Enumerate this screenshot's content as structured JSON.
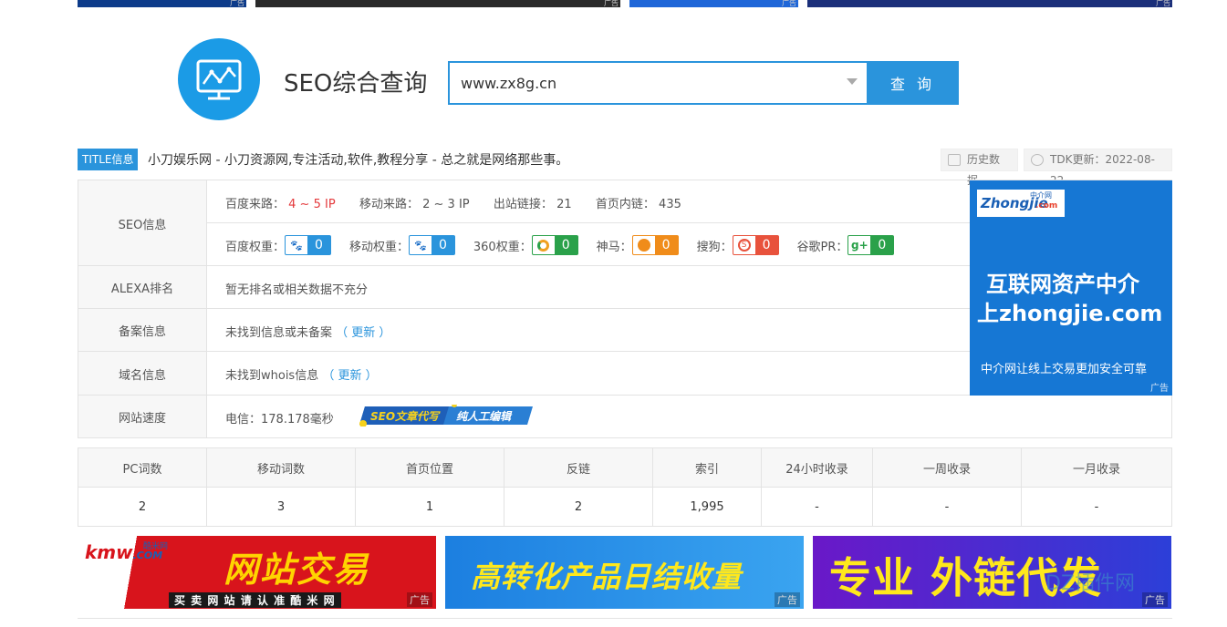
{
  "top_ads": {
    "ad_tag": "广告"
  },
  "header": {
    "page_title": "SEO综合查询",
    "search_value": "www.zx8g.cn",
    "search_button": "查 询"
  },
  "title_row": {
    "badge": "TITLE信息",
    "text": "小刀娱乐网 - 小刀资源网,专注活动,软件,教程分享 - 总之就是网络那些事。",
    "history_button": "历史数据",
    "tdk_update": "TDK更新：2022-08-22"
  },
  "seo_info": {
    "label": "SEO信息",
    "baidu_source_label": "百度来路：",
    "baidu_source_value": "4 ~ 5 IP",
    "mobile_source_label": "移动来路：",
    "mobile_source_value": "2 ~ 3 IP",
    "outbound_label": "出站链接：",
    "outbound_value": "21",
    "home_internal_label": "首页内链：",
    "home_internal_value": "435",
    "weights": [
      {
        "label": "百度权重：",
        "value": "0",
        "color": "#2a94dc",
        "icon": "paw-icon"
      },
      {
        "label": "移动权重：",
        "value": "0",
        "color": "#2a94dc",
        "icon": "paw-icon"
      },
      {
        "label": "360权重：",
        "value": "0",
        "color": "#2aa14a",
        "icon": "circle-360-icon"
      },
      {
        "label": "神马：",
        "value": "0",
        "color": "#f08c1a",
        "icon": "horse-icon"
      },
      {
        "label": "搜狗：",
        "value": "0",
        "color": "#e8523c",
        "icon": "sogou-icon"
      },
      {
        "label": "谷歌PR：",
        "value": "0",
        "color": "#2aa14a",
        "icon": "google-plus-icon"
      }
    ]
  },
  "alexa": {
    "label": "ALEXA排名",
    "value": "暂无排名或相关数据不充分"
  },
  "icp": {
    "label": "备案信息",
    "value": "未找到信息或未备案",
    "link": "（ 更新 ）"
  },
  "whois": {
    "label": "域名信息",
    "value": "未找到whois信息",
    "link": "（ 更新 ）"
  },
  "speed": {
    "label": "网站速度",
    "value": "电信：178.178毫秒",
    "banner_a": "SEO文章代写",
    "banner_b": "纯人工编辑"
  },
  "side_ad": {
    "brand": "Zhongjie",
    "brand_suffix": ".com",
    "brand_cn": "中介网",
    "line1": "互联网资产中介",
    "line2_prefix": "上",
    "line2_domain": "zhongjie.com",
    "line3": "中介网让线上交易更加安全可靠",
    "tag": "广告"
  },
  "stats": {
    "headers": [
      "PC词数",
      "移动词数",
      "首页位置",
      "反链",
      "索引",
      "24小时收录",
      "一周收录",
      "一月收录"
    ],
    "values": [
      "2",
      "3",
      "1",
      "2",
      "1,995",
      "-",
      "-",
      "-"
    ]
  },
  "bottom_ads": [
    {
      "brand": "kmw",
      "brand_suffix": ".COM",
      "brand_cn": "酷米网",
      "headline": "网站交易",
      "sub": "买 卖 网 站 请 认 准 酷 米 网",
      "tag": "广告"
    },
    {
      "headline": "高转化产品日结收量",
      "tag": "广告"
    },
    {
      "headline": "专业 外链代发",
      "tag": "广告"
    }
  ],
  "watermark": "DZ插件网"
}
